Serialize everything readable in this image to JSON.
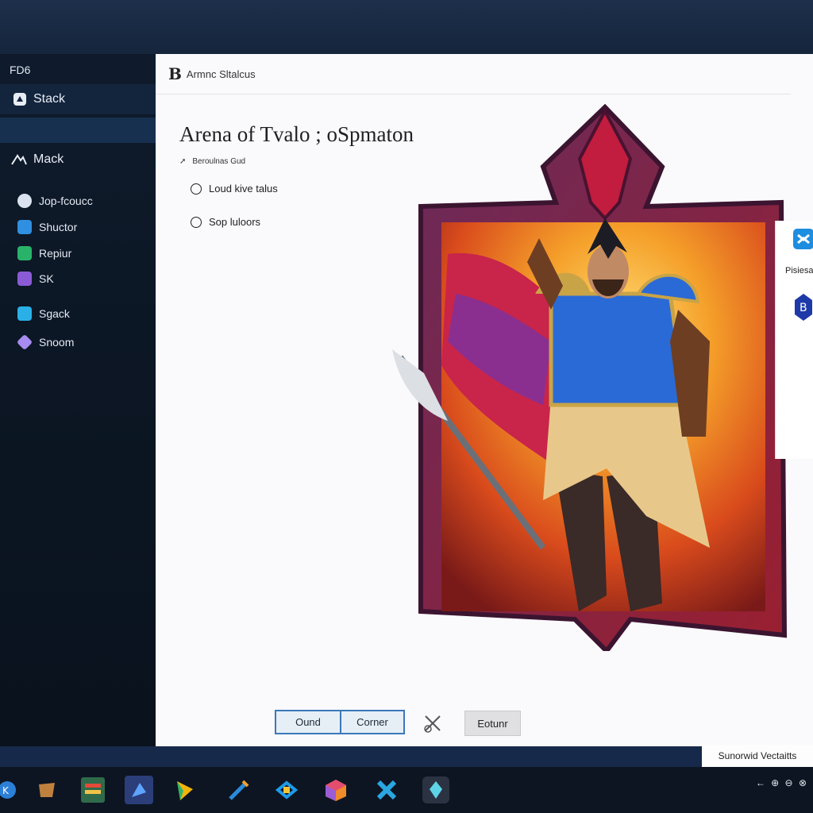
{
  "sidebar": {
    "title": "FD6",
    "stack_label": "Stack",
    "track_label": "Mack",
    "items": [
      {
        "label": "Jop-fcoucc",
        "icon": "puzzle-icon",
        "color": "#d9e2ee"
      },
      {
        "label": "Shuctor",
        "icon": "blue-cube-icon",
        "color": "#2f8fe0"
      },
      {
        "label": "Repiur",
        "icon": "green-leaf-icon",
        "color": "#29b36a"
      },
      {
        "label": "SK",
        "icon": "purple-gem-icon",
        "color": "#8b5bd6"
      },
      {
        "label": "Sgack",
        "icon": "teal-cross-icon",
        "color": "#2ab0e6"
      },
      {
        "label": "Snoom",
        "icon": "violet-crystal-icon",
        "color": "#a68cf0"
      }
    ]
  },
  "header": {
    "logo": "B",
    "title": "Armnc Sltalcus"
  },
  "main": {
    "page_title": "Arena of Tvalo ; oSpmaton",
    "subhead": "Beroulnas Gud",
    "options": [
      {
        "label": "Loud kive talus"
      },
      {
        "label": "Sop luloors"
      }
    ]
  },
  "right_panel": {
    "text": "Pisiesa"
  },
  "buttons": {
    "ound": "Ound",
    "corner": "Corner",
    "return": "Eotunr"
  },
  "notification": {
    "text": "Sunorwid Vectaitts"
  },
  "taskbar": {
    "apps": [
      "brown-app-icon",
      "green-stack-icon",
      "blue-arrow-icon",
      "yellow-flag-icon",
      "pen-icon",
      "blue-square-icon",
      "orange-cube-icon",
      "teal-x-icon",
      "gem-icon"
    ],
    "tray": "← ⊕ ⊖ ⊗"
  },
  "colors": {
    "sidebar_bg": "#0b1522",
    "accent": "#3a79b8",
    "main_bg": "#faf9fc",
    "frame": "#7a1f3c"
  }
}
